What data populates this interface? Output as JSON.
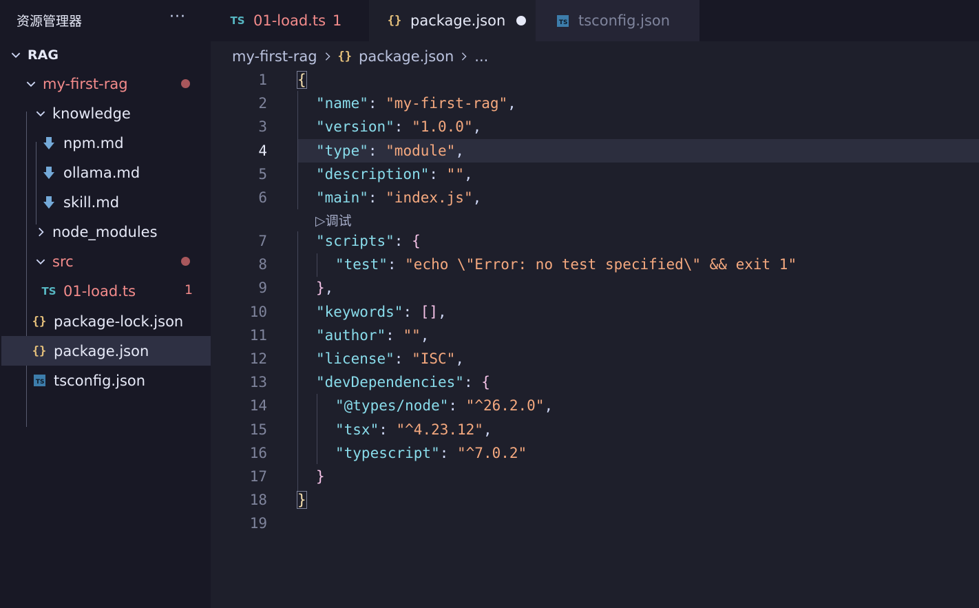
{
  "sidebar": {
    "title": "资源管理器",
    "more": "···",
    "items": [
      {
        "label": "RAG",
        "kind": "root"
      },
      {
        "label": "my-first-rag",
        "kind": "folder"
      },
      {
        "label": "knowledge",
        "kind": "folder"
      },
      {
        "label": "npm.md",
        "kind": "md"
      },
      {
        "label": "ollama.md",
        "kind": "md"
      },
      {
        "label": "skill.md",
        "kind": "md"
      },
      {
        "label": "node_modules",
        "kind": "folder"
      },
      {
        "label": "src",
        "kind": "folder"
      },
      {
        "label": "01-load.ts",
        "kind": "ts",
        "count": "1",
        "icon": "TS"
      },
      {
        "label": "package-lock.json",
        "kind": "json",
        "icon": "{}"
      },
      {
        "label": "package.json",
        "kind": "json",
        "icon": "{}"
      },
      {
        "label": "tsconfig.json",
        "kind": "tsconfig",
        "icon": "TS"
      }
    ]
  },
  "tabs": [
    {
      "label": "01-load.ts",
      "icon": "TS",
      "count": "1"
    },
    {
      "label": "package.json",
      "icon": "{}"
    },
    {
      "label": "tsconfig.json",
      "icon": "TS"
    }
  ],
  "breadcrumb": {
    "folder": "my-first-rag",
    "icon": "{}",
    "file": "package.json",
    "more": "..."
  },
  "editor": {
    "codelens": "▷调试",
    "line_numbers": [
      "1",
      "2",
      "3",
      "4",
      "5",
      "6",
      "7",
      "8",
      "9",
      "10",
      "11",
      "12",
      "13",
      "14",
      "15",
      "16",
      "17",
      "18",
      "19"
    ],
    "current_line": "4",
    "tokens": {
      "l1_brace": "{",
      "name_k": "\"name\"",
      "name_v": "\"my-first-rag\"",
      "version_k": "\"version\"",
      "version_v": "\"1.0.0\"",
      "type_k": "\"type\"",
      "type_v": "\"module\"",
      "description_k": "\"description\"",
      "description_v": "\"\"",
      "main_k": "\"main\"",
      "main_v": "\"index.js\"",
      "scripts_k": "\"scripts\"",
      "open_brace": "{",
      "test_k": "\"test\"",
      "test_v": "\"echo \\\"Error: no test specified\\\" && exit 1\"",
      "close_brace": "}",
      "keywords_k": "\"keywords\"",
      "keywords_v": "[]",
      "author_k": "\"author\"",
      "author_v": "\"\"",
      "license_k": "\"license\"",
      "license_v": "\"ISC\"",
      "devdeps_k": "\"devDependencies\"",
      "types_node_k": "\"@types/node\"",
      "types_node_v": "\"^26.2.0\"",
      "tsx_k": "\"tsx\"",
      "tsx_v": "\"^4.23.12\"",
      "typescript_k": "\"typescript\"",
      "typescript_v": "\"^7.0.2\"",
      "l18_brace": "}",
      "colon": ": ",
      "comma": ","
    }
  },
  "colors": {
    "background": "#1e1f2b",
    "sidebar": "#181825",
    "key": "#89dceb",
    "string": "#f5a97f",
    "modified": "#f38b8b"
  }
}
